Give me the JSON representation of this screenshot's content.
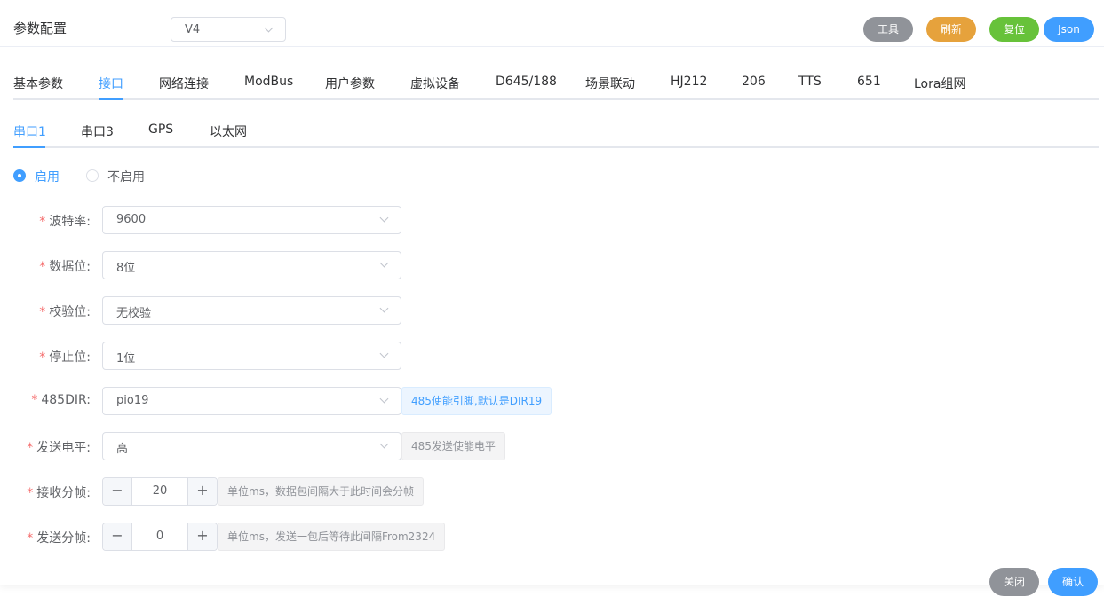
{
  "header": {
    "title": "参数配置",
    "version": "V4",
    "buttons": {
      "tools": "工具",
      "refresh": "刷新",
      "reset": "复位",
      "json": "Json"
    }
  },
  "tabs": [
    "基本参数",
    "接口",
    "网络连接",
    "ModBus",
    "用户参数",
    "虚拟设备",
    "D645/188",
    "场景联动",
    "HJ212",
    "206",
    "TTS",
    "651",
    "Lora组网"
  ],
  "active_tab": "接口",
  "subtabs": [
    "串口1",
    "串口3",
    "GPS",
    "以太网"
  ],
  "active_subtab": "串口1",
  "radio": {
    "enable": "启用",
    "disable": "不启用",
    "selected": "启用"
  },
  "form": {
    "baud_rate": {
      "label": "波特率:",
      "value": "9600"
    },
    "data_bits": {
      "label": "数据位:",
      "value": "8位"
    },
    "parity": {
      "label": "校验位:",
      "value": "无校验"
    },
    "stop_bits": {
      "label": "停止位:",
      "value": "1位"
    },
    "dir485": {
      "label": "485DIR:",
      "value": "pio19",
      "hint": "485使能引脚,默认是DIR19"
    },
    "send_level": {
      "label": "发送电平:",
      "value": "高",
      "hint": "485发送使能电平"
    },
    "recv_frame": {
      "label": "接收分帧:",
      "value": "20",
      "hint": "单位ms，数据包间隔大于此时间会分帧"
    },
    "send_frame": {
      "label": "发送分帧:",
      "value": "0",
      "hint": "单位ms，发送一包后等待此间隔From2324"
    }
  },
  "footer": {
    "close": "关闭",
    "confirm": "确认"
  },
  "colors": {
    "primary": "#409eff",
    "warning": "#e6a23c",
    "success": "#67c23a",
    "info": "#909399",
    "required": "#f56c6c"
  }
}
